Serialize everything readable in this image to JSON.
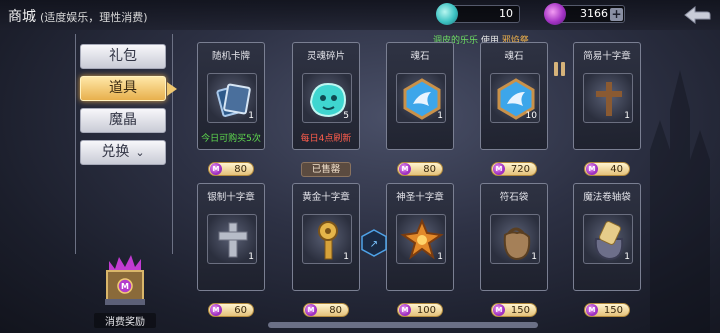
{
  "header": {
    "title": "商城",
    "subtitle": "(适度娱乐，理性消费)",
    "currencies": [
      {
        "icon": "crystal-gem-icon",
        "value": "10"
      },
      {
        "icon": "magic-coin-icon",
        "value": "3166"
      }
    ],
    "plus_label": "+"
  },
  "menu": {
    "items": [
      {
        "label": "礼包",
        "active": false
      },
      {
        "label": "道具",
        "active": true
      },
      {
        "label": "魔晶",
        "active": false
      },
      {
        "label": "兑换",
        "active": false,
        "dropdown": true
      }
    ],
    "dropdown_glyph": "⌄",
    "reward_label": "消费奖励"
  },
  "event": {
    "text1": "调皮的乐乐",
    "text2": "使用",
    "text3": "邪焰祭"
  },
  "currency_badge": "M",
  "shop": {
    "items": [
      {
        "name": "随机卡牌",
        "count": "1",
        "note": "今日可购买5次",
        "note_color": "green",
        "price": "80",
        "sold": false,
        "icon": "card-pack-icon"
      },
      {
        "name": "灵魂碎片",
        "count": "5",
        "note": "每日4点刷新",
        "note_color": "red",
        "price": null,
        "sold": true,
        "sold_label": "已售罄",
        "icon": "soul-shard-icon"
      },
      {
        "name": "魂石",
        "count": "1",
        "note": "",
        "price": "80",
        "sold": false,
        "icon": "soul-stone-icon"
      },
      {
        "name": "魂石",
        "count": "10",
        "note": "",
        "price": "720",
        "sold": false,
        "icon": "soul-stone-icon"
      },
      {
        "name": "简易十字章",
        "count": "1",
        "note": "",
        "price": "40",
        "sold": false,
        "icon": "wooden-cross-icon"
      },
      {
        "name": "银制十字章",
        "count": "1",
        "note": "",
        "price": "60",
        "sold": false,
        "icon": "silver-cross-icon"
      },
      {
        "name": "黄金十字章",
        "count": "1",
        "note": "",
        "price": "80",
        "sold": false,
        "icon": "gold-cross-icon"
      },
      {
        "name": "神圣十字章",
        "count": "1",
        "note": "",
        "price": "100",
        "sold": false,
        "icon": "holy-cross-icon"
      },
      {
        "name": "符石袋",
        "count": "1",
        "note": "",
        "price": "150",
        "sold": false,
        "icon": "rune-bag-icon"
      },
      {
        "name": "魔法卷轴袋",
        "count": "1",
        "note": "",
        "price": "150",
        "sold": false,
        "icon": "scroll-bag-icon"
      }
    ]
  },
  "colors": {
    "accent_gold": "#e8b04d",
    "note_green": "#5fdc4f",
    "note_red": "#ff5d4c"
  }
}
